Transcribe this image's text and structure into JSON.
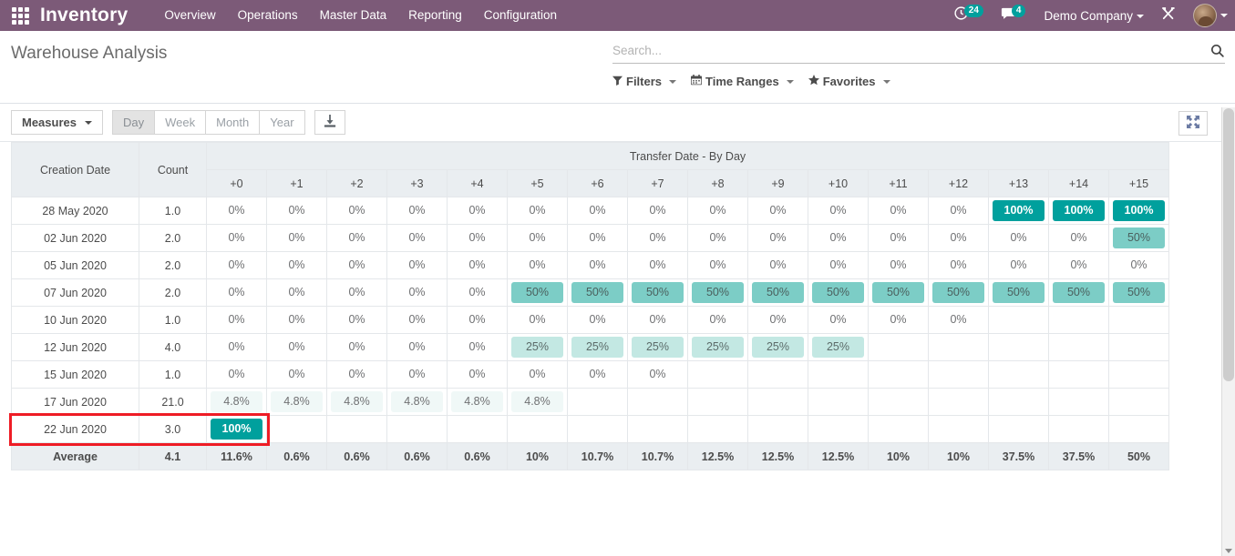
{
  "topbar": {
    "apps_icon": "apps-grid-icon",
    "brand": "Inventory",
    "menus": [
      "Overview",
      "Operations",
      "Master Data",
      "Reporting",
      "Configuration"
    ],
    "activities": {
      "icon": "clock-icon",
      "count": "24"
    },
    "messages": {
      "icon": "chat-bubble-icon",
      "count": "4"
    },
    "company": "Demo Company",
    "tools_icon": "wrench-screwdriver-icon",
    "avatar": "user-avatar"
  },
  "control_panel": {
    "title": "Warehouse Analysis",
    "search": {
      "placeholder": "Search...",
      "value": "",
      "icon": "search-icon"
    },
    "filters": [
      {
        "label": "Filters",
        "icon": "funnel-icon"
      },
      {
        "label": "Time Ranges",
        "icon": "calendar-icon"
      },
      {
        "label": "Favorites",
        "icon": "star-icon"
      }
    ]
  },
  "toolbar": {
    "measures_label": "Measures",
    "intervals": [
      {
        "label": "Day",
        "active": true
      },
      {
        "label": "Week",
        "active": false
      },
      {
        "label": "Month",
        "active": false
      },
      {
        "label": "Year",
        "active": false
      }
    ],
    "download_icon": "download-icon",
    "expand_icon": "expand-arrows-icon"
  },
  "pivot": {
    "row_header": "Creation Date",
    "count_header": "Count",
    "col_group_header": "Transfer Date - By Day",
    "columns": [
      "+0",
      "+1",
      "+2",
      "+3",
      "+4",
      "+5",
      "+6",
      "+7",
      "+8",
      "+9",
      "+10",
      "+11",
      "+12",
      "+13",
      "+14",
      "+15"
    ],
    "rows": [
      {
        "label": "28 May 2020",
        "count": "1.0",
        "cells": [
          "0%",
          "0%",
          "0%",
          "0%",
          "0%",
          "0%",
          "0%",
          "0%",
          "0%",
          "0%",
          "0%",
          "0%",
          "0%",
          "100%",
          "100%",
          "100%"
        ]
      },
      {
        "label": "02 Jun 2020",
        "count": "2.0",
        "cells": [
          "0%",
          "0%",
          "0%",
          "0%",
          "0%",
          "0%",
          "0%",
          "0%",
          "0%",
          "0%",
          "0%",
          "0%",
          "0%",
          "0%",
          "0%",
          "50%"
        ]
      },
      {
        "label": "05 Jun 2020",
        "count": "2.0",
        "cells": [
          "0%",
          "0%",
          "0%",
          "0%",
          "0%",
          "0%",
          "0%",
          "0%",
          "0%",
          "0%",
          "0%",
          "0%",
          "0%",
          "0%",
          "0%",
          "0%"
        ]
      },
      {
        "label": "07 Jun 2020",
        "count": "2.0",
        "cells": [
          "0%",
          "0%",
          "0%",
          "0%",
          "0%",
          "50%",
          "50%",
          "50%",
          "50%",
          "50%",
          "50%",
          "50%",
          "50%",
          "50%",
          "50%",
          "50%"
        ]
      },
      {
        "label": "10 Jun 2020",
        "count": "1.0",
        "cells": [
          "0%",
          "0%",
          "0%",
          "0%",
          "0%",
          "0%",
          "0%",
          "0%",
          "0%",
          "0%",
          "0%",
          "0%",
          "0%",
          "",
          "",
          ""
        ]
      },
      {
        "label": "12 Jun 2020",
        "count": "4.0",
        "cells": [
          "0%",
          "0%",
          "0%",
          "0%",
          "0%",
          "25%",
          "25%",
          "25%",
          "25%",
          "25%",
          "25%",
          "",
          "",
          "",
          "",
          ""
        ]
      },
      {
        "label": "15 Jun 2020",
        "count": "1.0",
        "cells": [
          "0%",
          "0%",
          "0%",
          "0%",
          "0%",
          "0%",
          "0%",
          "0%",
          "",
          "",
          "",
          "",
          "",
          "",
          "",
          ""
        ]
      },
      {
        "label": "17 Jun 2020",
        "count": "21.0",
        "cells": [
          "4.8%",
          "4.8%",
          "4.8%",
          "4.8%",
          "4.8%",
          "4.8%",
          "",
          "",
          "",
          "",
          "",
          "",
          "",
          "",
          "",
          ""
        ]
      },
      {
        "label": "22 Jun 2020",
        "count": "3.0",
        "highlighted": true,
        "cells": [
          "100%",
          "",
          "",
          "",
          "",
          "",
          "",
          "",
          "",
          "",
          "",
          "",
          "",
          "",
          "",
          ""
        ]
      }
    ],
    "total_row": {
      "label": "Average",
      "count": "4.1",
      "cells": [
        "11.6%",
        "0.6%",
        "0.6%",
        "0.6%",
        "0.6%",
        "10%",
        "10.7%",
        "10.7%",
        "12.5%",
        "12.5%",
        "12.5%",
        "10%",
        "10%",
        "37.5%",
        "37.5%",
        "50%"
      ]
    }
  },
  "colors": {
    "brand_purple": "#7c5a78",
    "teal": "#00a09d",
    "teal_mid": "#7ccdc6",
    "teal_light": "#c3e8e3",
    "highlight_red": "#ee1c25"
  }
}
